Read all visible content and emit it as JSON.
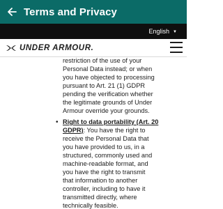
{
  "appbar": {
    "title": "Terms and Privacy"
  },
  "language": {
    "label": "English"
  },
  "brand": {
    "name": "UNDER ARMOUR."
  },
  "content": {
    "prev_lines": [
      "restriction of the use of your",
      "Personal Data instead; or when",
      "you have objected to processing",
      "pursuant to Art. 21 (1) GDPR",
      "pending the verification whether",
      "the legitimate grounds of Under",
      "Armour override your grounds."
    ],
    "item": {
      "title_line1": "Right to data portability (Art. 20",
      "title_line2": "GDPR)",
      "line2_rest": ": You have the right to",
      "lines": [
        "receive the Personal Data that",
        "you have provided to us, in a",
        "structured, commonly used and",
        "machine-readable format, and",
        "you have the right to transmit",
        "that information to another",
        "controller, including to have it",
        "transmitted directly, where",
        "technically feasible."
      ]
    }
  }
}
